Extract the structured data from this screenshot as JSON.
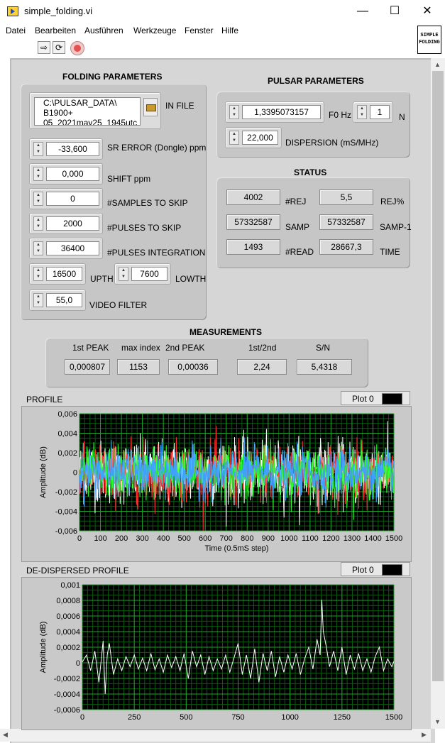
{
  "window": {
    "title": "simple_folding.vi",
    "minimize": "—",
    "maximize": "☐",
    "close": "✕"
  },
  "menu": [
    "Datei",
    "Bearbeiten",
    "Ausführen",
    "Werkzeuge",
    "Fenster",
    "Hilfe"
  ],
  "toolbar": {
    "run_icon": "run-arrow-icon",
    "run_continuous_icon": "run-continuously-icon",
    "abort_icon": "abort-stop-icon"
  },
  "vi_icon": {
    "line1": "SIMPLE",
    "line2": "FOLDING"
  },
  "folding": {
    "title": "FOLDING PARAMETERS",
    "in_file": {
      "label": "IN FILE",
      "line1": "C:\\PULSAR_DATA\\",
      "line2": "B1900+",
      "line3": "05_2021may25_1945utc"
    },
    "sr_error": {
      "label": "SR ERROR (Dongle) ppm",
      "value": "-33,600"
    },
    "shift": {
      "label": "SHIFT ppm",
      "value": "0,000"
    },
    "samples_skip": {
      "label": "#SAMPLES TO SKIP",
      "value": "0"
    },
    "pulses_skip": {
      "label": "#PULSES TO SKIP",
      "value": "2000"
    },
    "pulses_integration": {
      "label": "#PULSES INTEGRATION",
      "value": "36400"
    },
    "upth": {
      "label": "UPTH",
      "value": "16500"
    },
    "lowth": {
      "label": "LOWTH",
      "value": "7600"
    },
    "video_filter": {
      "label": "VIDEO FILTER",
      "value": "55,0"
    }
  },
  "pulsar": {
    "title": "PULSAR PARAMETERS",
    "f0": {
      "label": "F0 Hz",
      "value": "1,3395073157"
    },
    "n": {
      "label": "N",
      "value": "1"
    },
    "dispersion": {
      "label": "DISPERSION (mS/MHz)",
      "value": "22,000"
    }
  },
  "status": {
    "title": "STATUS",
    "rej": {
      "label": "#REJ",
      "value": "4002"
    },
    "rej_pct": {
      "label": "REJ%",
      "value": "5,5"
    },
    "samp": {
      "label": "SAMP",
      "value": "57332587"
    },
    "samp_1": {
      "label": "SAMP-1",
      "value": "57332587"
    },
    "read": {
      "label": "#READ",
      "value": "1493"
    },
    "time": {
      "label": "TIME",
      "value": "28667,3"
    }
  },
  "measurements": {
    "title": "MEASUREMENTS",
    "first_peak": {
      "label": "1st PEAK",
      "value": "0,000807"
    },
    "max_index": {
      "label": "max index",
      "value": "1153"
    },
    "second_peak": {
      "label": "2nd PEAK",
      "value": "0,00036"
    },
    "ratio": {
      "label": "1st/2nd",
      "value": "2,24"
    },
    "sn": {
      "label": "S/N",
      "value": "5,4318"
    }
  },
  "chart_data": [
    {
      "type": "line",
      "title": "PROFILE",
      "legend": "Plot 0",
      "xlabel": "Time (0.5mS step)",
      "ylabel": "Amplitude (dB)",
      "xlim": [
        0,
        1500
      ],
      "ylim": [
        -0.006,
        0.006
      ],
      "xticks": [
        "0",
        "100",
        "200",
        "300",
        "400",
        "500",
        "600",
        "700",
        "800",
        "900",
        "1000",
        "1100",
        "1200",
        "1300",
        "1400",
        "1500"
      ],
      "yticks": [
        "0,006",
        "0,004",
        "0,002",
        "0",
        "-0,002",
        "-0,004",
        "-0,006"
      ],
      "grid": true,
      "series": [
        {
          "color": "#ffffff",
          "noise_std": 0.0016,
          "points": 1500
        },
        {
          "color": "#ff3030",
          "noise_std": 0.0015,
          "points": 1500
        },
        {
          "color": "#30ff30",
          "noise_std": 0.0013,
          "points": 1500
        },
        {
          "color": "#40a0ff",
          "noise_std": 0.0012,
          "points": 1500
        }
      ]
    },
    {
      "type": "line",
      "title": "DE-DISPERSED PROFILE",
      "legend": "Plot 0",
      "xlabel": "",
      "ylabel": "Amplitude (dB)",
      "xlim": [
        0,
        1500
      ],
      "ylim": [
        -0.0006,
        0.001
      ],
      "xticks": [
        "0",
        "250",
        "500",
        "750",
        "1000",
        "1250",
        "1500"
      ],
      "yticks": [
        "0,001",
        "0,0008",
        "0,0006",
        "0,0004",
        "0,0002",
        "0",
        "-0,0002",
        "-0,0004",
        "-0,0006"
      ],
      "grid": true,
      "series": [
        {
          "color": "#ffffff",
          "x": [
            0,
            20,
            40,
            60,
            80,
            100,
            110,
            120,
            130,
            150,
            170,
            190,
            210,
            230,
            250,
            270,
            290,
            310,
            330,
            350,
            370,
            390,
            410,
            430,
            450,
            470,
            490,
            510,
            530,
            550,
            570,
            590,
            610,
            630,
            650,
            670,
            690,
            710,
            730,
            750,
            770,
            790,
            810,
            830,
            850,
            870,
            890,
            910,
            930,
            950,
            970,
            990,
            1010,
            1030,
            1050,
            1070,
            1090,
            1110,
            1130,
            1145,
            1153,
            1160,
            1175,
            1190,
            1210,
            1230,
            1250,
            1270,
            1290,
            1310,
            1330,
            1350,
            1370,
            1390,
            1410,
            1430,
            1450,
            1470,
            1490,
            1500
          ],
          "y": [
            1e-05,
            0.0001,
            -0.0001,
            0.00015,
            -0.00025,
            0.00028,
            -0.0004,
            0.0001,
            0.00025,
            -0.00015,
            5e-05,
            -0.0001,
            8e-05,
            -5e-05,
            0.0001,
            -8e-05,
            6e-05,
            -0.0001,
            0.00012,
            -9e-05,
            5e-05,
            -0.00012,
            0.0001,
            -6e-05,
            8e-05,
            -0.0001,
            0.00012,
            -0.0002,
            0.00015,
            -5e-05,
            0.0001,
            -0.00015,
            8e-05,
            -0.0001,
            5e-05,
            -8e-05,
            0.0001,
            -0.00012,
            6e-05,
            0.00025,
            -0.00015,
            0.0001,
            -0.0002,
            0.00018,
            -0.00025,
            0.00012,
            -0.0001,
            0.00015,
            -0.00018,
            8e-05,
            -0.00012,
            0.0001,
            -8e-05,
            0.00012,
            -0.00015,
            5e-05,
            0.0002,
            -8e-05,
            0.0003,
            0.0001,
            0.000807,
            0.0004,
            0.0002,
            -5e-05,
            0.00015,
            -0.0001,
            0.0002,
            -0.00015,
            0.0001,
            -8e-05,
            0.00012,
            -0.0001,
            5e-05,
            -0.00012,
            8e-05,
            0.0002,
            -0.0001,
            5e-05,
            -5e-05,
            2e-05
          ]
        }
      ]
    }
  ]
}
